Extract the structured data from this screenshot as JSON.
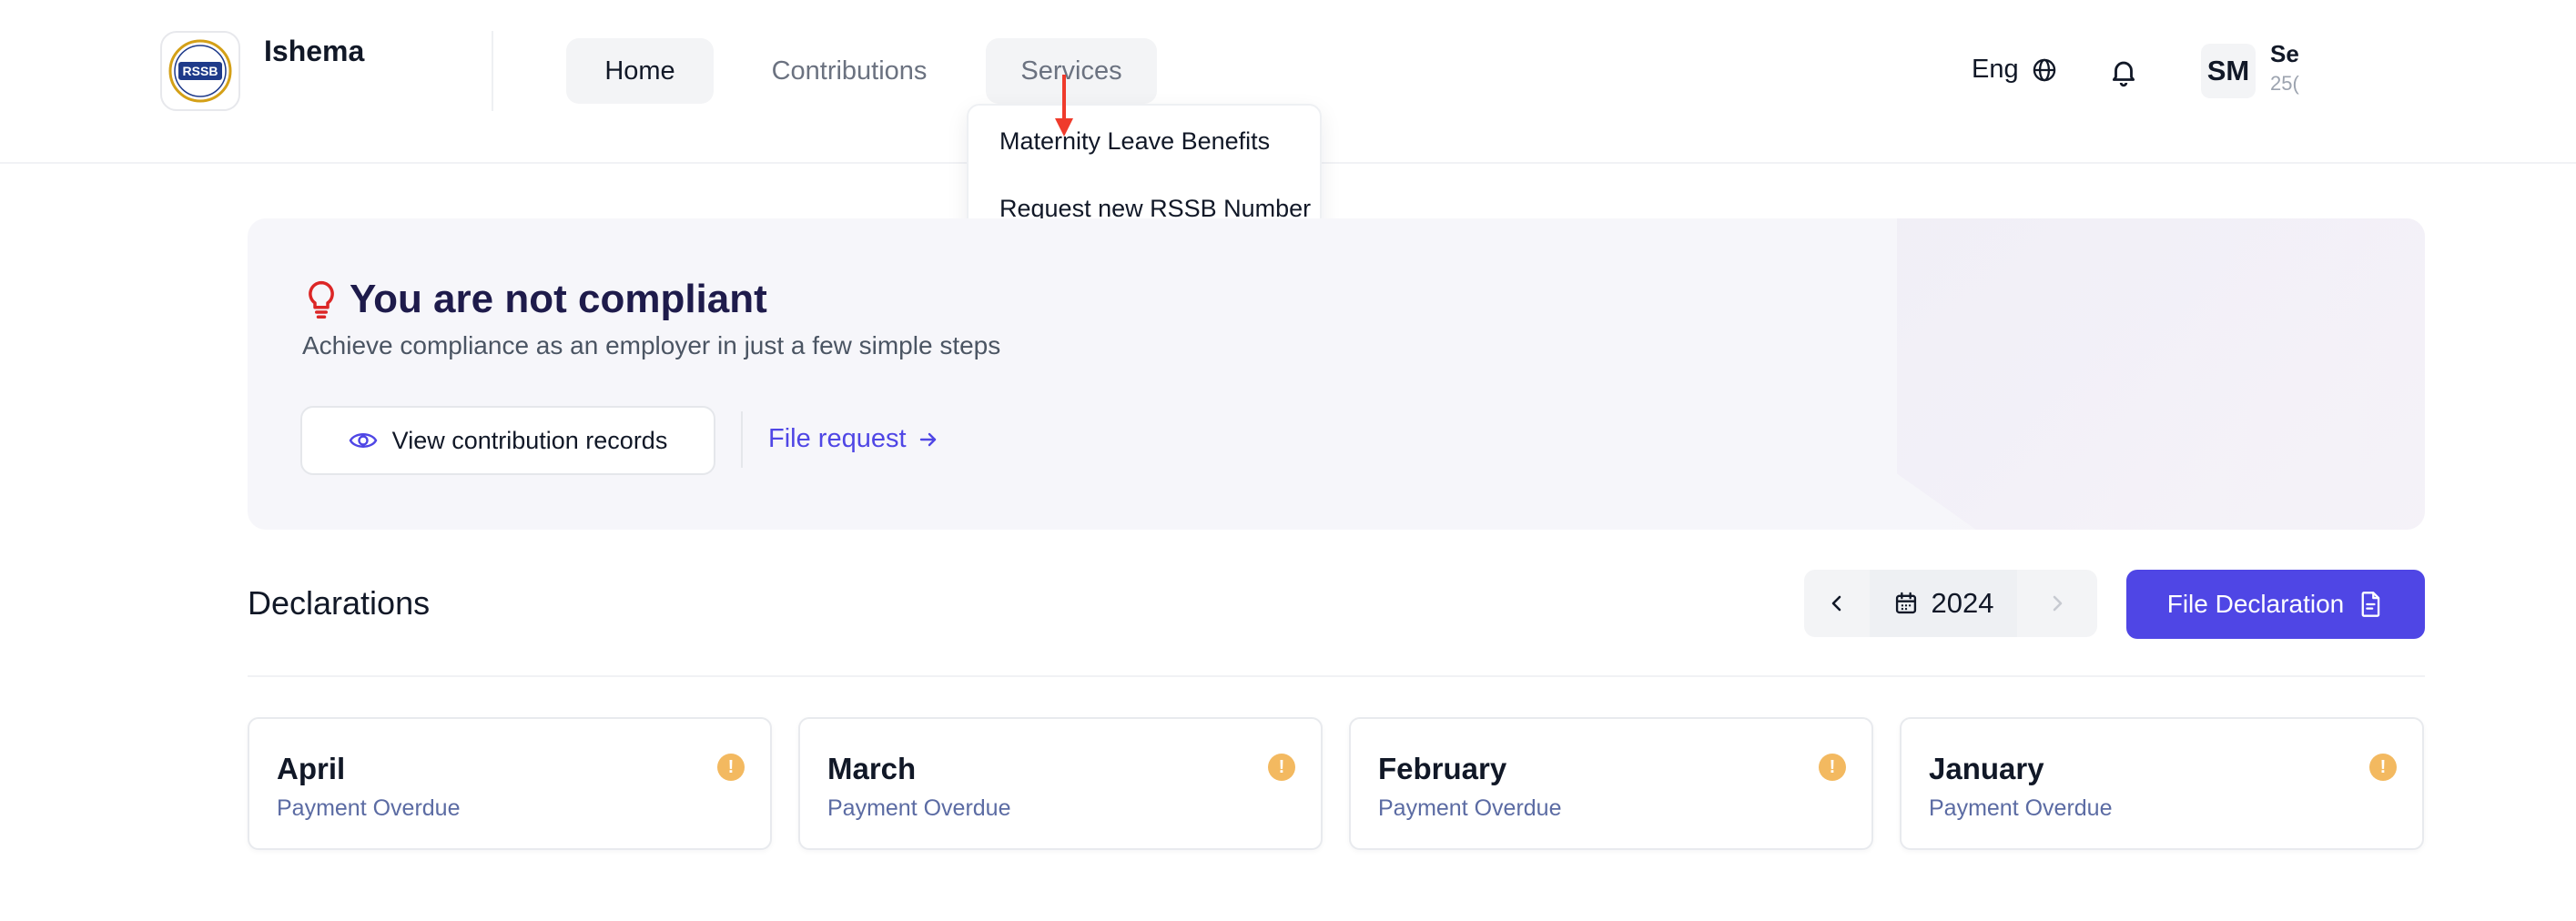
{
  "header": {
    "app_name": "Ishema",
    "logo_text": "RSSB",
    "nav": [
      {
        "label": "Home"
      },
      {
        "label": "Contributions"
      },
      {
        "label": "Services"
      }
    ],
    "services_menu": [
      {
        "label": "Maternity Leave Benefits"
      },
      {
        "label": "Request new RSSB Number"
      }
    ],
    "language": "Eng",
    "user": {
      "initials": "SM",
      "name": "Se",
      "sub": "25("
    }
  },
  "banner": {
    "title": "You are not compliant",
    "subtitle": "Achieve compliance as an employer in just a few simple steps",
    "view_button": "View contribution records",
    "file_request_link": "File request"
  },
  "declarations": {
    "title": "Declarations",
    "year": "2024",
    "file_button": "File Declaration",
    "cards": [
      {
        "month": "April",
        "status": "Payment Overdue"
      },
      {
        "month": "March",
        "status": "Payment Overdue"
      },
      {
        "month": "February",
        "status": "Payment Overdue"
      },
      {
        "month": "January",
        "status": "Payment Overdue"
      }
    ]
  },
  "colors": {
    "accent": "#4f46e5",
    "title": "#1e1b4b",
    "warning": "#f3b960",
    "alert_icon": "#dc2626",
    "annotation_arrow": "#ef3b2c"
  }
}
